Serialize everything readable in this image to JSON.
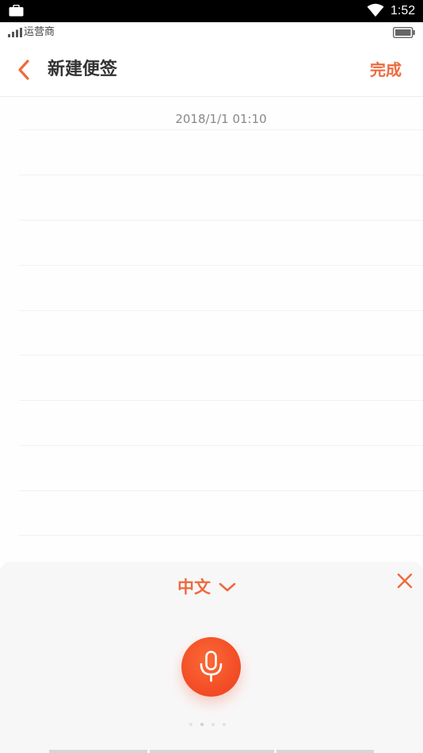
{
  "status_bar": {
    "time": "1:52",
    "icons": [
      "briefcase-icon",
      "wifi-icon"
    ]
  },
  "carrier_row": {
    "carrier": "运营商",
    "icons": [
      "signal-icon",
      "battery-icon"
    ]
  },
  "header": {
    "title": "新建便签",
    "done_label": "完成",
    "back_icon": "chevron-left-icon"
  },
  "note": {
    "date": "2018/1/1 01:10"
  },
  "voice_panel": {
    "language": "中文",
    "dropdown_icon": "chevron-down-icon",
    "close_icon": "close-icon",
    "mic_icon": "microphone-icon",
    "page_dots": 4,
    "active_dot": 2
  },
  "colors": {
    "accent": "#ee6a3e",
    "mic": "#f24a25",
    "title_text": "#333333",
    "date_text": "#888888"
  }
}
